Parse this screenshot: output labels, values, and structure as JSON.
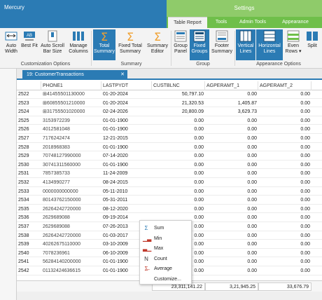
{
  "app": {
    "title": "Mercury"
  },
  "settings_banner": "Settings",
  "tabs": [
    "Table Report",
    "Tools",
    "Admin Tools",
    "Appearance"
  ],
  "ribbon": {
    "buttons": [
      {
        "label": "Auto Width",
        "icon": "auto-width-icon"
      },
      {
        "label": "Best Fit",
        "icon": "best-fit-icon"
      },
      {
        "label": "Auto Scroll Bar Size",
        "icon": "auto-scroll-icon"
      },
      {
        "label": "Manage Columns",
        "icon": "manage-columns-icon"
      },
      {
        "label": "Total Summary",
        "icon": "sigma-icon"
      },
      {
        "label": "Fixed Total Summary",
        "icon": "sigma-icon"
      },
      {
        "label": "Summary Editor",
        "icon": "sigma-icon"
      },
      {
        "label": "Group Panel",
        "icon": "group-panel-icon"
      },
      {
        "label": "Fixed Groups",
        "icon": "fixed-groups-icon"
      },
      {
        "label": "Footer Summary",
        "icon": "footer-summary-icon"
      },
      {
        "label": "Vertical Lines",
        "icon": "vertical-lines-icon"
      },
      {
        "label": "Horizontal Lines",
        "icon": "horizontal-lines-icon"
      },
      {
        "label": "Even Rows ▾",
        "icon": "even-rows-icon"
      },
      {
        "label": "Split",
        "icon": "split-icon"
      }
    ],
    "groups": [
      "Customization Options",
      "Summary",
      "Group",
      "Appearance Options"
    ]
  },
  "doc_tab": {
    "label": "19: CustomerTransactions",
    "pin": "⊤",
    "close": "✕"
  },
  "grid": {
    "columns": [
      "PHONE1",
      "LASTPYDT",
      "CUSTBLNC",
      "AGPERAMT_1",
      "AGPERAMT_2"
    ],
    "rows": [
      [
        "2522",
        "⊞41455501130000",
        "01-20-2024",
        "50,797.10",
        "0.00",
        "0.00"
      ],
      [
        "2523",
        "⊞60855501210000",
        "01-20-2024",
        "21,320.53",
        "1,405.87",
        "0.00"
      ],
      [
        "2524",
        "⊞31755501020000",
        "02-24-2026",
        "20,800.09",
        "3,629.73",
        "0.00"
      ],
      [
        "2525",
        "3153972239",
        "01-01-1900",
        "0.00",
        "0.00",
        "0.00"
      ],
      [
        "2526",
        "4012581048",
        "01-01-1900",
        "0.00",
        "0.00",
        "0.00"
      ],
      [
        "2527",
        "7176242474",
        "12-21-2015",
        "0.00",
        "0.00",
        "0.00"
      ],
      [
        "2528",
        "2018968383",
        "01-01-1900",
        "0.00",
        "0.00",
        "0.00"
      ],
      [
        "2529",
        "70748127990000",
        "07-14-2020",
        "0.00",
        "0.00",
        "0.00"
      ],
      [
        "2530",
        "30741311560000",
        "01-01-1900",
        "0.00",
        "0.00",
        "0.00"
      ],
      [
        "2531",
        "7857385733",
        "11-24-2009",
        "0.00",
        "0.00",
        "0.00"
      ],
      [
        "2532",
        "4134990277",
        "08-24-2015",
        "0.00",
        "0.00",
        "0.00"
      ],
      [
        "2533",
        "0000000000000",
        "05-11-2010",
        "0.00",
        "0.00",
        "0.00"
      ],
      [
        "2534",
        "80143762150000",
        "05-31-2011",
        "0.00",
        "0.00",
        "0.00"
      ],
      [
        "2535",
        "26264242720000",
        "08-12-2020",
        "0.00",
        "0.00",
        "0.00"
      ],
      [
        "2536",
        "2629689088",
        "09-19-2014",
        "0.00",
        "0.00",
        "0.00"
      ],
      [
        "2537",
        "2629689088",
        "07-26-2013",
        "0.00",
        "0.00",
        "0.00"
      ],
      [
        "2538",
        "26264242720000",
        "01-03-2017",
        "0.00",
        "0.00",
        "0.00"
      ],
      [
        "2539",
        "40262675110000",
        "03-10-2009",
        "0.00",
        "0.00",
        "0.00"
      ],
      [
        "2540",
        "7078236961",
        "06-10-2009",
        "0.00",
        "0.00",
        "0.00"
      ],
      [
        "2541",
        "56284140200000",
        "01-01-1900",
        "0.00",
        "0.00",
        "0.00"
      ],
      [
        "2542",
        "01132424636615",
        "01-01-1900",
        "0.00",
        "0.00",
        "0.00"
      ]
    ],
    "footer": [
      "23,311,141.22",
      "3,21,945.25",
      "33,676.79"
    ]
  },
  "context_menu": {
    "items": [
      {
        "label": "Sum",
        "icon": "Σ",
        "color": "#2b7bb4"
      },
      {
        "label": "Min",
        "icon": "▁▃",
        "color": "#c0392b"
      },
      {
        "label": "Max",
        "icon": "▃▁",
        "color": "#c0392b"
      },
      {
        "label": "Count",
        "icon": "N",
        "color": "#333333"
      },
      {
        "label": "Average",
        "icon": "Σ̶",
        "color": "#c0392b"
      },
      {
        "label": "Customize...",
        "icon": "",
        "color": "#333333"
      }
    ]
  }
}
